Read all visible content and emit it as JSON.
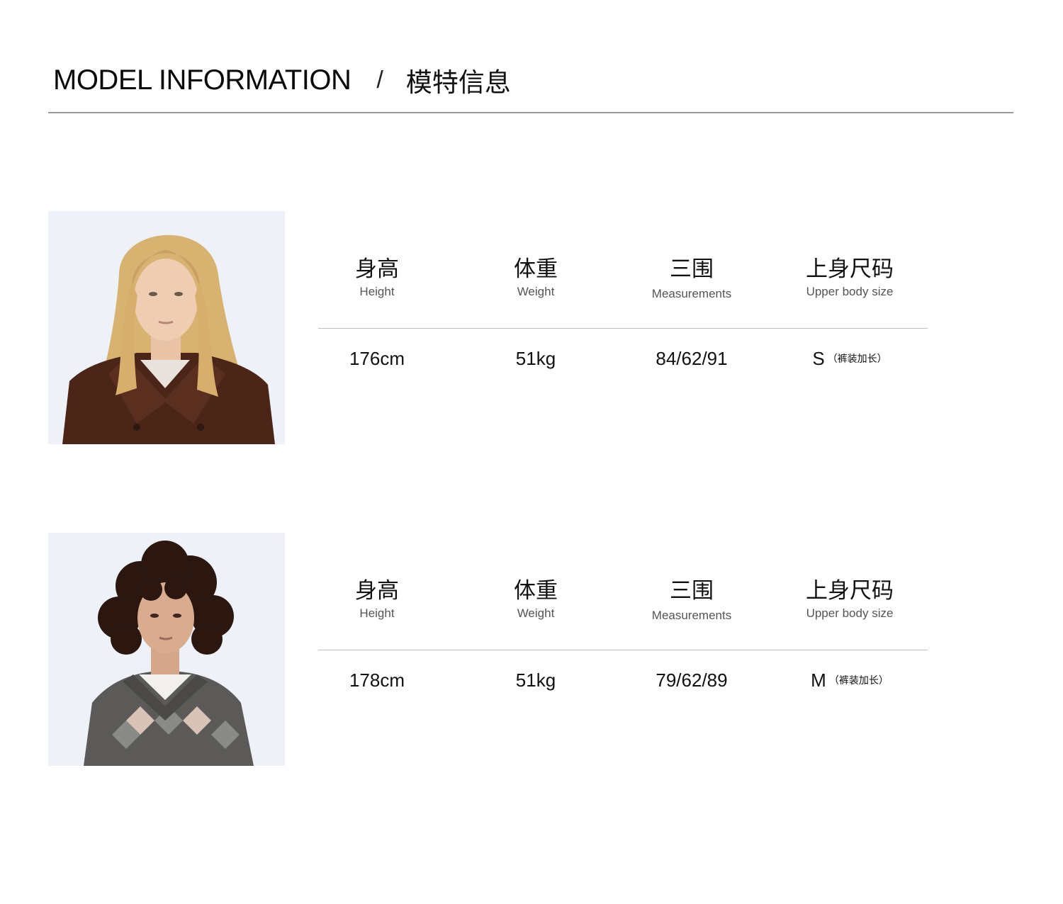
{
  "header": {
    "title_en": "MODEL INFORMATION",
    "separator": "/",
    "title_cn": "模特信息"
  },
  "labels": {
    "height_cn": "身高",
    "height_en": "Height",
    "weight_cn": "体重",
    "weight_en": "Weight",
    "measurements_cn": "三围",
    "measurements_en": "Measurements",
    "size_cn": "上身尺码",
    "size_en": "Upper body size"
  },
  "models": [
    {
      "photo_icon": "model-portrait-blonde-wavy-hair",
      "height": "176cm",
      "weight": "51kg",
      "measurements": "84/62/91",
      "size": "S",
      "size_note": "（裤装加长）"
    },
    {
      "photo_icon": "model-portrait-curly-dark-hair",
      "height": "178cm",
      "weight": "51kg",
      "measurements": "79/62/89",
      "size": "M",
      "size_note": "（裤装加长）"
    }
  ],
  "colors": {
    "photo_bg": "#eef2f8",
    "rule": "#9a9a9a",
    "text": "#111111",
    "subtext": "#555555"
  }
}
